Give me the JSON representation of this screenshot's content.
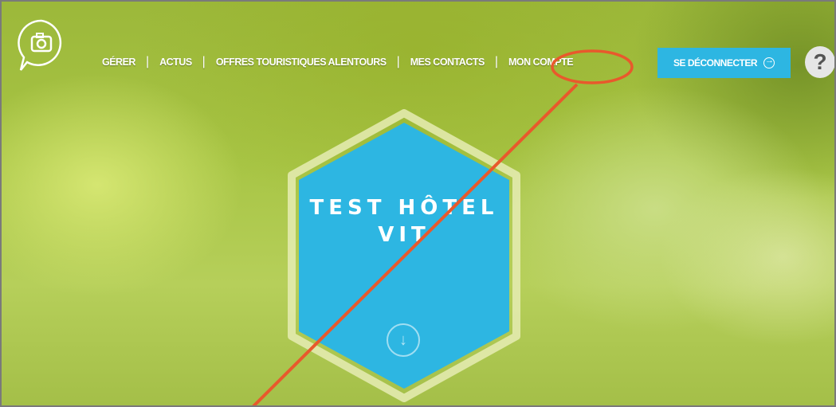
{
  "nav": {
    "items": [
      {
        "label": "GÉRER"
      },
      {
        "label": "ACTUS"
      },
      {
        "label": "OFFRES TOURISTIQUES ALENTOURS"
      },
      {
        "label": "MES CONTACTS"
      },
      {
        "label": "MON COMPTE"
      }
    ],
    "separator": "|",
    "highlighted_item": "MON COMPTE"
  },
  "logout_button": {
    "label": "SE DÉCONNECTER",
    "icon": "arrow-circle-right-icon"
  },
  "help_button": {
    "label": "?"
  },
  "hero": {
    "title_line1": "TEST HÔTEL",
    "title_line2": "VIT",
    "scroll_icon": "arrow-down-circle-icon"
  },
  "colors": {
    "accent": "#2db6e2",
    "annotation": "#e8592c",
    "hex_border": "#e6ecb4",
    "background": "#a8c545"
  }
}
